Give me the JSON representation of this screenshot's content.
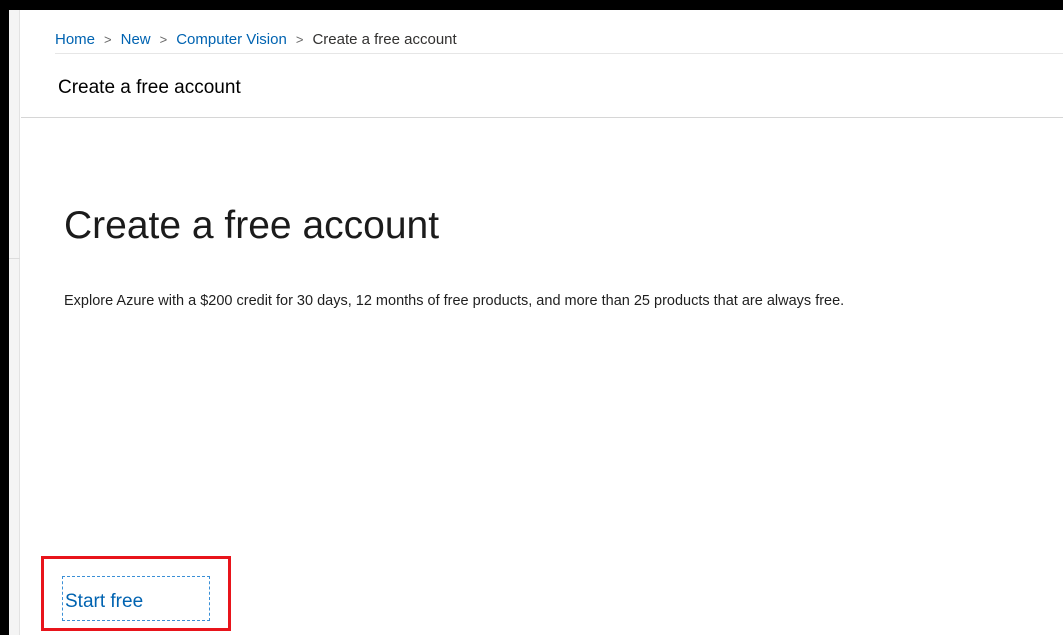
{
  "breadcrumb": {
    "items": [
      "Home",
      "New",
      "Computer Vision"
    ],
    "current": "Create a free account",
    "separator": ">"
  },
  "header": {
    "title": "Create a free account"
  },
  "main": {
    "heading": "Create a free account",
    "description": "Explore Azure with a $200 credit for 30 days, 12 months of free products, and more than 25 products that are always free.",
    "start_button_label": "Start free"
  },
  "colors": {
    "link": "#0063b1",
    "highlight": "#e8141b",
    "focus_outline": "#3a8fd6"
  }
}
